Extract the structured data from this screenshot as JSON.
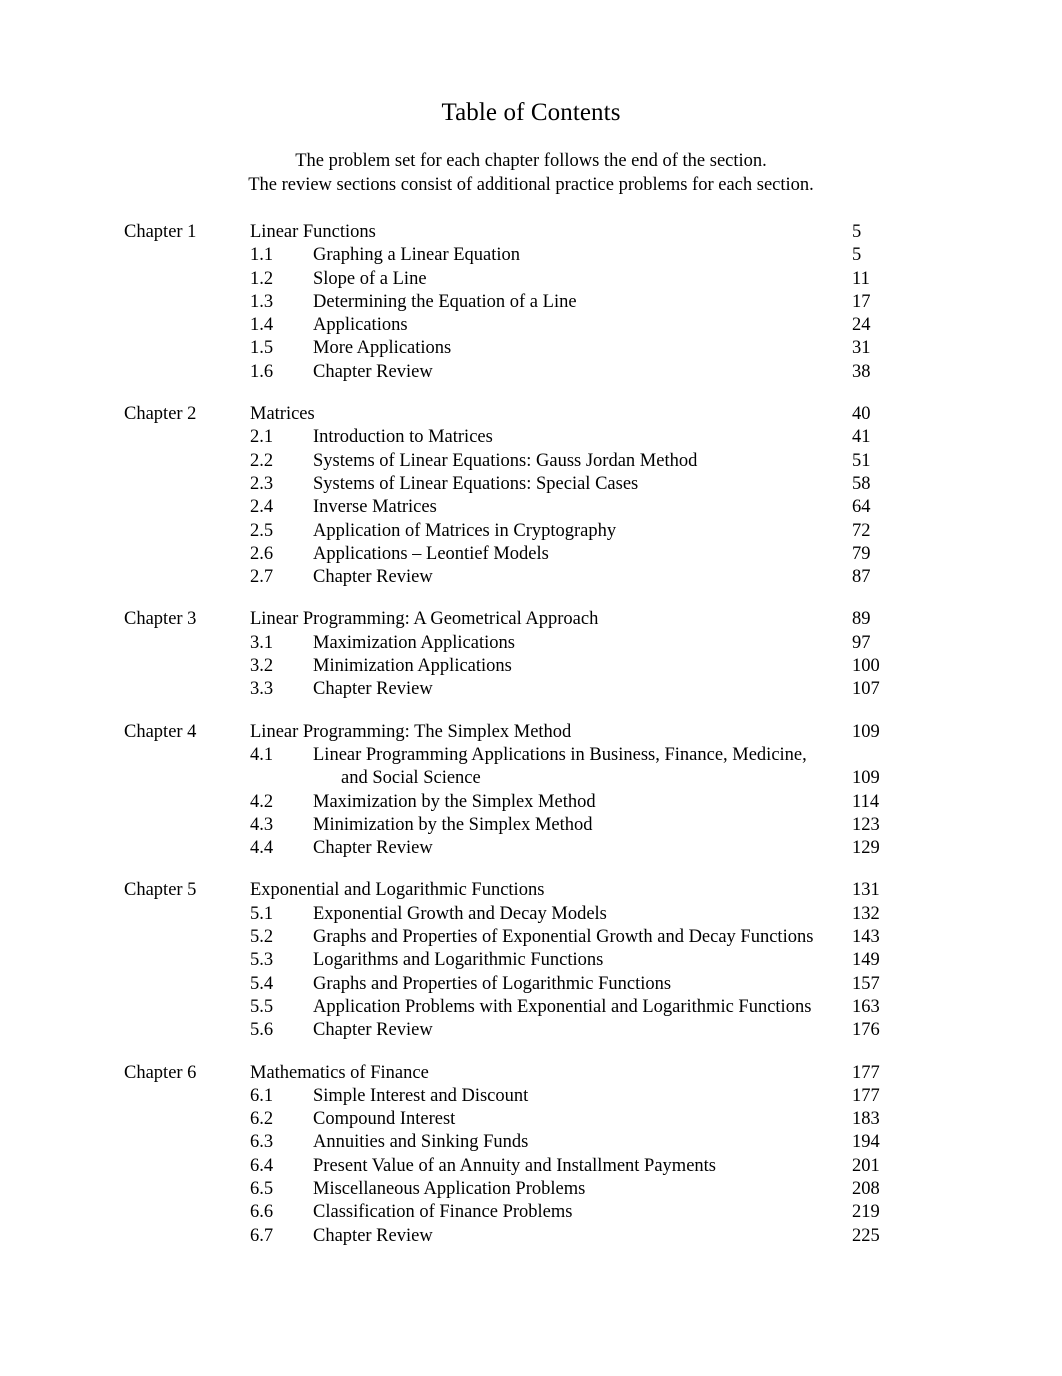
{
  "document": {
    "title": "Table of Contents",
    "subtitle_lines": [
      "The problem set for each chapter follows the end of the section.",
      "The review sections consist of additional practice problems for each section."
    ]
  },
  "toc": {
    "chapters": [
      {
        "label": "Chapter 1",
        "title": "Linear Functions",
        "page": "5",
        "sections": [
          {
            "num": "1.1",
            "title": "Graphing a Linear Equation",
            "page": "5"
          },
          {
            "num": "1.2",
            "title": "Slope of a Line",
            "page": "11"
          },
          {
            "num": "1.3",
            "title": "Determining the Equation of a Line",
            "page": "17"
          },
          {
            "num": "1.4",
            "title": "Applications",
            "page": "24"
          },
          {
            "num": "1.5",
            "title": "More Applications",
            "page": "31"
          },
          {
            "num": "1.6",
            "title": "Chapter Review",
            "page": "38"
          }
        ]
      },
      {
        "label": "Chapter 2",
        "title": "Matrices",
        "page": "40",
        "sections": [
          {
            "num": "2.1",
            "title": "Introduction to Matrices",
            "page": "41"
          },
          {
            "num": "2.2",
            "title": "Systems of Linear Equations: Gauss Jordan Method",
            "page": "51"
          },
          {
            "num": "2.3",
            "title": "Systems of Linear Equations: Special Cases",
            "page": "58"
          },
          {
            "num": "2.4",
            "title": "Inverse Matrices",
            "page": "64"
          },
          {
            "num": "2.5",
            "title": "Application of Matrices in Cryptography",
            "page": "72"
          },
          {
            "num": "2.6",
            "title": "Applications – Leontief Models",
            "page": "79"
          },
          {
            "num": "2.7",
            "title": "Chapter Review",
            "page": "87"
          }
        ]
      },
      {
        "label": "Chapter 3",
        "title": "Linear Programming: A Geometrical Approach",
        "page": "89",
        "sections": [
          {
            "num": "3.1",
            "title": "Maximization Applications",
            "page": "97"
          },
          {
            "num": "3.2",
            "title": "Minimization Applications",
            "page": "100"
          },
          {
            "num": "3.3",
            "title": "Chapter Review",
            "page": "107"
          }
        ]
      },
      {
        "label": "Chapter 4",
        "title": "Linear Programming: The Simplex Method",
        "page": "109",
        "sections": [
          {
            "num": "4.1",
            "title": "Linear Programming Applications in Business, Finance, Medicine,",
            "title_cont": "and Social Science",
            "page": "109"
          },
          {
            "num": "4.2",
            "title": "Maximization by the Simplex Method",
            "page": "114"
          },
          {
            "num": "4.3",
            "title": "Minimization by the Simplex Method",
            "page": "123"
          },
          {
            "num": "4.4",
            "title": "Chapter Review",
            "page": "129"
          }
        ]
      },
      {
        "label": "Chapter 5",
        "title": "Exponential and Logarithmic Functions",
        "page": "131",
        "sections": [
          {
            "num": "5.1",
            "title": "Exponential Growth and Decay Models",
            "page": "132"
          },
          {
            "num": "5.2",
            "title": "Graphs and Properties of Exponential Growth and Decay Functions",
            "page": "143"
          },
          {
            "num": "5.3",
            "title": "Logarithms and Logarithmic Functions",
            "page": "149"
          },
          {
            "num": "5.4",
            "title": "Graphs and Properties of Logarithmic Functions",
            "page": "157"
          },
          {
            "num": "5.5",
            "title": "Application Problems with Exponential and Logarithmic Functions",
            "page": "163"
          },
          {
            "num": "5.6",
            "title": "Chapter Review",
            "page": "176"
          }
        ]
      },
      {
        "label": "Chapter 6",
        "title": "Mathematics of Finance",
        "page": "177",
        "sections": [
          {
            "num": "6.1",
            "title": "Simple Interest and Discount",
            "page": "177"
          },
          {
            "num": "6.2",
            "title": "Compound Interest",
            "page": "183"
          },
          {
            "num": "6.3",
            "title": "Annuities and Sinking Funds",
            "page": "194"
          },
          {
            "num": "6.4",
            "title": "Present Value of an Annuity and Installment Payments",
            "page": "201"
          },
          {
            "num": "6.5",
            "title": "Miscellaneous Application Problems",
            "page": "208"
          },
          {
            "num": "6.6",
            "title": "Classification of Finance Problems",
            "page": "219"
          },
          {
            "num": "6.7",
            "title": "Chapter Review",
            "page": "225"
          }
        ]
      }
    ]
  }
}
